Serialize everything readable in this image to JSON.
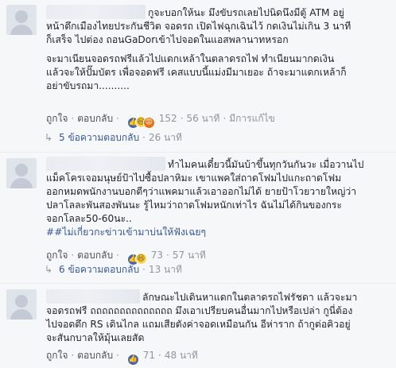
{
  "comments": [
    {
      "line1": "กูจะบอกให้นะ มึงขับรถเลยไปนิดนึงมีตู้ ATM อยู่",
      "line2": "หน้าตึกเมืองไทยประกันชีวิต จอดรถ เปิดไฟฉุกเฉินไว้ กดเงินไม่เกิน 3 นาที",
      "line3": "ก็เสร็จ ไปต่อง ถอนGaDorเข้าไปจอดในแอสพลานาทหรอก",
      "para2_line1": "จะมาเนียนจอดรถฟรีแล้วไปแดกเหล้าในตลาดรถไฟ ทำเนียนมากดเงิน",
      "para2_line2": "แล้วจะให้ปั๊มบัตร เพื่อจอดฟรี เคสแบบนี้แม่งมีมาเยอะ ถ้าจะมาแดกเหล้าก็",
      "para2_line3": "อย่าขับรถมา..........",
      "like_label": "ถูกใจ",
      "reply_label": "ตอบกลับ",
      "reaction_count": "152",
      "time": "56 นาที",
      "edited": "มีการแก้ไข"
    },
    {
      "line1": "ทำไมคนเดี๋ยวนี้มันบ้าขึ้นทุกวันกันวะ เมื่อวานไป",
      "line2": "แม็คโครเจอมนุษย์ป้าไปซื้อปลาหิมะ เขาแพคใส่ถาดโฟมไปแกะถาดโฟม",
      "line3": "ออกหมดพนักงานบอกตีๆว่าแพคมาแล้วเอาออกไม่ได้ ยายป้าโวยวายใหญ่ว่า",
      "line4": "ปลาโลละพันสองพันนะ รู้ไหมว่าถาดโฟมหนักเท่าไร ฉันไม่ได้กินของกระ",
      "line5": "จอกโลละ50-60นะ..",
      "hashtag": "##ไม่เกี่ยวกะข่าวเข้ามาบ่นให้ฟังเฉยๆ",
      "like_label": "ถูกใจ",
      "reply_label": "ตอบกลับ",
      "reaction_count": "73",
      "time": "57 นาที"
    },
    {
      "line1": "ลักษณะไปเดินหาแดกในตลาดรถไฟรัชดา แล้วจะมา",
      "line2": "จอดรถฟรี ถถถถถถถถถถถถถถ มึงเอาเปรียบคนอื่นมากไปหรือเปล่า กูนี่ต้อง",
      "line3": "ไปจอดตึก RS เดินไกล แถมเสียตังค่าจอดเหมือนกัน อีห่าราก ถ้ากูต่อคิวอยู่",
      "line4": "จะสันกบาลให้มุ้นเลยสัด",
      "like_label": "ถูกใจ",
      "reply_label": "ตอบกลับ",
      "reaction_count": "71",
      "time": "48 นาที"
    }
  ],
  "reply_threads": [
    {
      "label": "5 ข้อความตอบกลับ",
      "time": "26 นาที"
    },
    {
      "label": "6 ข้อความตอบกลับ",
      "time": "13 นาที"
    }
  ],
  "colors": {
    "link": "#365899",
    "meta": "#90949c",
    "like": "#4267b2"
  }
}
